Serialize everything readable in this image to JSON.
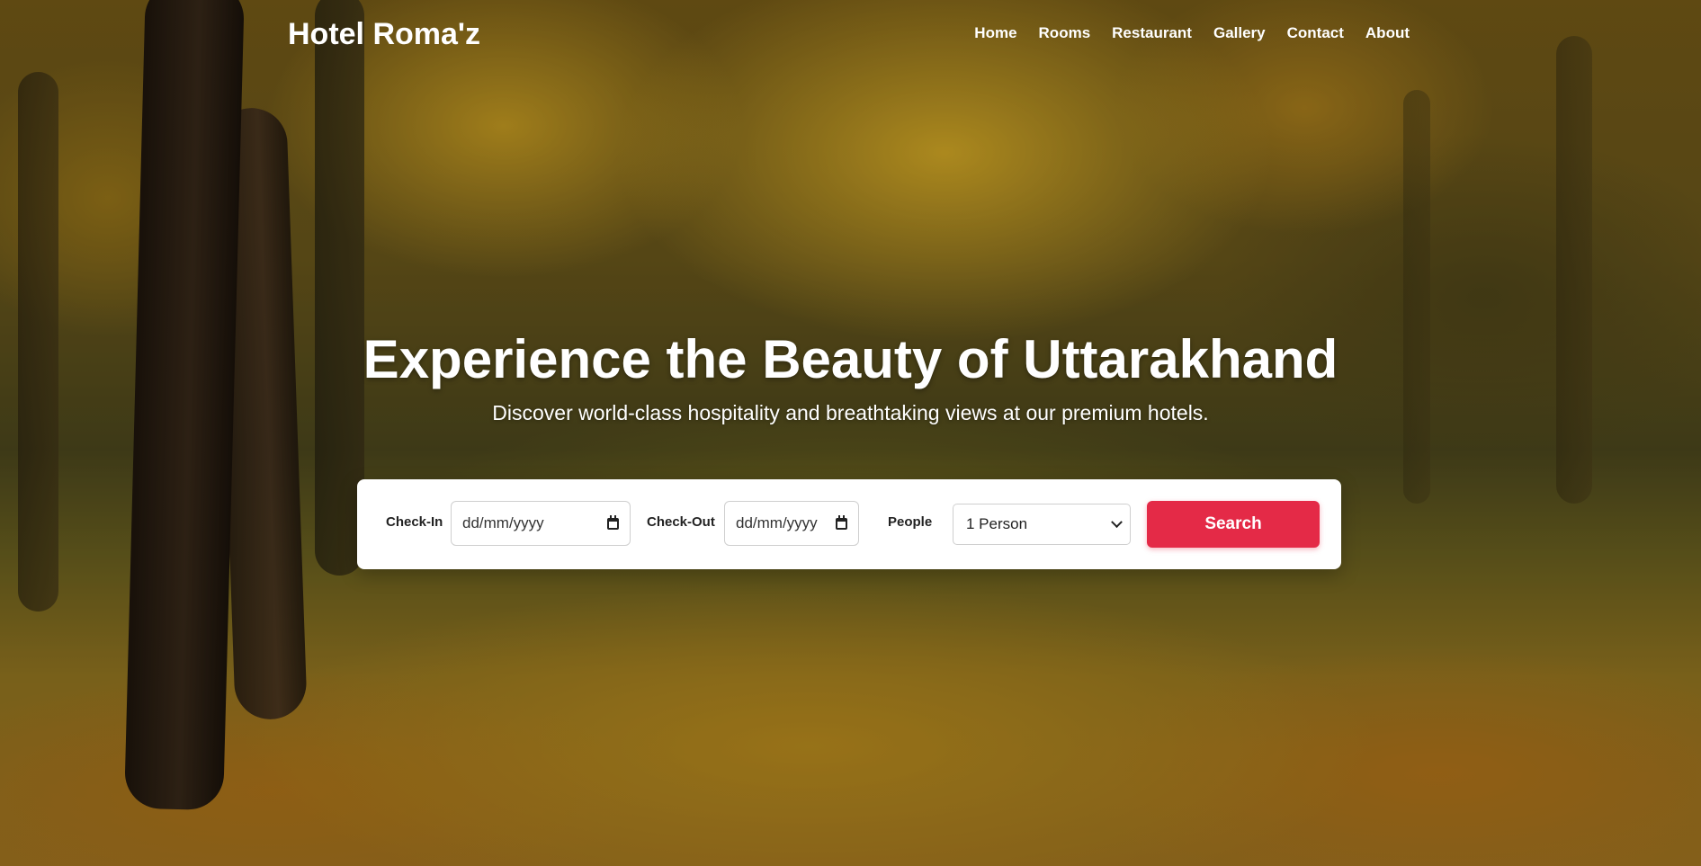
{
  "brand": {
    "name": "Hotel Roma'z"
  },
  "nav": {
    "items": [
      {
        "label": "Home"
      },
      {
        "label": "Rooms"
      },
      {
        "label": "Restaurant"
      },
      {
        "label": "Gallery"
      },
      {
        "label": "Contact"
      },
      {
        "label": "About"
      }
    ]
  },
  "hero": {
    "title": "Experience the Beauty of Uttarakhand",
    "subtitle": "Discover world-class hospitality and breathtaking views at our premium hotels.",
    "background_icon": "autumn-forest-background"
  },
  "booking": {
    "checkin_label": "Check-In",
    "checkin_placeholder": "dd/mm/yyyy",
    "checkout_label": "Check-Out",
    "checkout_placeholder": "dd/mm/yyyy",
    "people_label": "People",
    "people_selected": "1 Person",
    "search_label": "Search",
    "calendar_icon": "calendar-icon",
    "dropdown_icon": "chevron-down-icon"
  },
  "colors": {
    "accent": "#e42a47",
    "text_light": "#ffffff",
    "panel_bg": "#ffffff"
  }
}
